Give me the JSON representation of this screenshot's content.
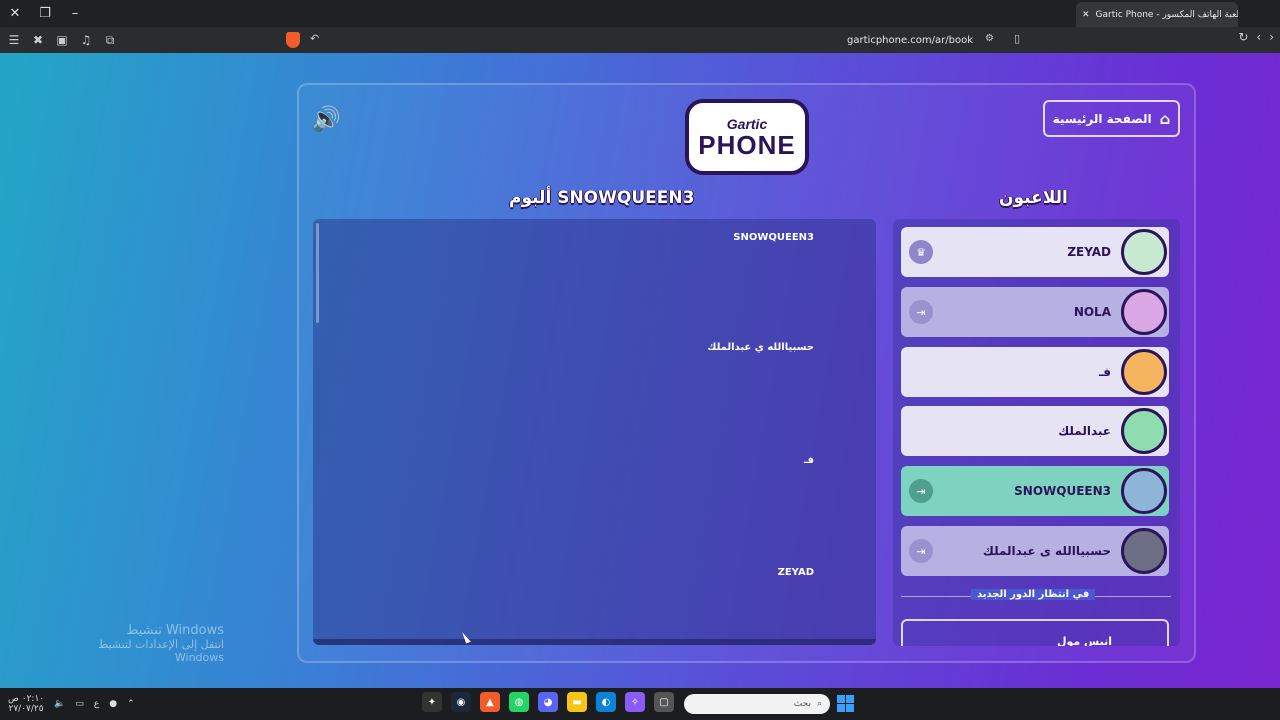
{
  "browser": {
    "tab_title": "Gartic Phone - لعبة الهاتف المكسور",
    "url": "garticphone.com/ar/book",
    "window_close": "✕",
    "window_restore": "❐",
    "window_min": "–",
    "new_tab": "+",
    "tab_close": "✕"
  },
  "game": {
    "logo_top": "Gartic",
    "logo_bottom": "PHONE",
    "home_button": "الصفحة الرئيسية",
    "album_title": "ألبوم SNOWQUEEN3",
    "players_title": "اللاعبون",
    "album_entries": [
      "SNOWQUEEN3",
      "حسبياالله ي عبدالملك",
      "فـ",
      "ZEYAD"
    ],
    "players": [
      {
        "name": "ZEYAD",
        "state": "host"
      },
      {
        "name": "NOLA",
        "state": "done"
      },
      {
        "name": "فـ",
        "state": "none"
      },
      {
        "name": "عبدالملك",
        "state": "none"
      },
      {
        "name": "SNOWQUEEN3",
        "state": "active"
      },
      {
        "name": "حسبياالله ى عبدالملك",
        "state": "done"
      }
    ],
    "waiting_label": "في انتظار الدور الجديد",
    "waiting_player": "انيس مول"
  },
  "watermark": {
    "title": "تنشيط Windows",
    "subtitle": "انتقل إلى الإعدادات لتنشيط Windows"
  },
  "taskbar": {
    "time": "٠٢:١٠ ص",
    "date": "٢٧/٠٧/٢٥",
    "search_placeholder": "بحث",
    "lang": "ع"
  },
  "colors": {
    "accent_dark": "#2b1459",
    "row_light": "#e6e3f5",
    "row_active": "#7ed3c0",
    "row_done": "#b7b0e3"
  }
}
